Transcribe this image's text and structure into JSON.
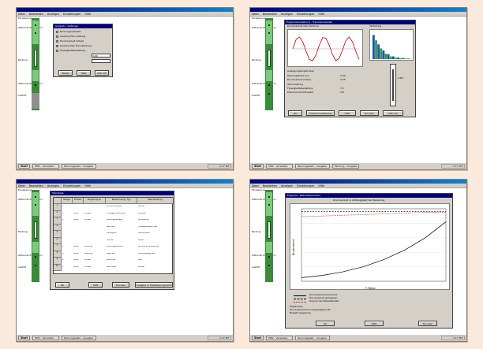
{
  "colors": {
    "desktop": "#fbe9dc",
    "titlebar": "#000080",
    "face": "#d4d0c8",
    "column": "#3a8a3a",
    "column_light": "#7fc97f"
  },
  "app": {
    "menu": [
      "Datei",
      "Bearbeiten",
      "Anzeigen",
      "Einstellungen",
      "Hilfe"
    ],
    "side_labels": {
      "top": "Einspeisung",
      "upper": "Gitterrost (Einbauten)",
      "middle": "Packung",
      "lower": "Gitterrost (Einbauten)",
      "bottom": "Austritt"
    },
    "taskbar": {
      "start": "Start",
      "task1": "PPW - Verwalten",
      "task2": "Packungswahl - Ausgabe",
      "task3": "Packung - Ausgabe",
      "tray": "2:17 PM"
    }
  },
  "shot1": {
    "dialog_title": "Auswahl - Optionen",
    "options": [
      "Packungsauswahl",
      "Gewünschte Leistung",
      "Druckverlust (mbar)",
      "Gewünschte Trennleistung",
      "Flüssigkeitsbelastung"
    ],
    "selected_index": 2,
    "field_value": "100",
    "buttons": [
      "Weiter",
      "Hilfe",
      "Abbruch"
    ]
  },
  "shot2": {
    "dialog_title": "Ergebnisdarstellung - Trennkennzahlen",
    "left_caption": "Druckverlust über Kolonne",
    "right_caption": "Verteilung",
    "info_lines": [
      "Auslegungsergebnisse",
      "Packungshöhe (m)",
      "Druckverlust (mbar)",
      "Trennleistung",
      "Flüssigkeitsbelastung",
      "Kolonnendurchmesser"
    ],
    "info_values": [
      "1,50",
      "4,35",
      "7,2",
      "3,8",
      "0,80"
    ],
    "buttons": [
      "OK",
      "Zusammenfassung",
      "Hilfe",
      "Drucken",
      "Abbruch"
    ]
  },
  "shot3": {
    "dialog_title": "Stückliste",
    "columns": [
      "Menge",
      "Einheit",
      "Zugehörig zu",
      "Bezeichnung / Typ",
      "Beschreibung"
    ],
    "rows": [
      [
        "1",
        "",
        "",
        "Kolonnenmantel",
        "Mantel"
      ],
      [
        "1",
        "Stück",
        "Einbau",
        "Flüssigkeitsverteiler",
        "Verteiler"
      ],
      [
        "2",
        "Stück",
        "Einbau",
        "Packungsauflage",
        "Auflagerost"
      ],
      [
        "",
        "",
        "",
        "Sammler",
        "Flüssigkeitssammler"
      ],
      [
        "",
        "",
        "",
        "Haltegitter",
        "Niederhalter"
      ],
      [
        "",
        "",
        "",
        "Stutzen",
        "Zulauf"
      ],
      [
        "1",
        "Stück",
        "Packung",
        "Packungselement",
        "Strukturierte Packung"
      ],
      [
        "4",
        "Stück",
        "Packung",
        "Segment",
        "Packungssegment"
      ],
      [
        "2",
        "Stück",
        "Einbau",
        "Gitterrost",
        "Rost"
      ],
      [
        "1",
        "Stück",
        "Einbau",
        "Abschluss",
        "Deckel"
      ]
    ],
    "buttons": [
      "OK",
      "Hilfe",
      "Drucken",
      "Ausgabe in Tabellenprogramm"
    ]
  },
  "shot4": {
    "dialog_title": "Ergebnis - Betriebskennlinie",
    "chart_caption": "Druckverlust in Abhängigkeit der Belastung",
    "x_label": "F-Faktor",
    "y_label": "Druckverlust",
    "legend": [
      "Druckverlust berechnet",
      "Druckverlust gemessen",
      "Grenze der Belastbarkeit"
    ],
    "notes": [
      "Ergebnisse",
      "Druckverlust bei Auslegungspunkt",
      "Belastungsgrenze"
    ],
    "buttons": [
      "OK",
      "Hilfe",
      "Drucken"
    ],
    "chart_data": {
      "type": "line",
      "series": [
        {
          "x": [
            0,
            0.5,
            1,
            1.5,
            2,
            2.5,
            3,
            3.5
          ],
          "y": [
            0.5,
            0.8,
            1.3,
            2.0,
            3.0,
            4.3,
            6.0,
            8.2
          ]
        },
        {
          "x": [
            0,
            0.5,
            1,
            1.5,
            2,
            2.5,
            3,
            3.5
          ],
          "y": [
            9.6,
            9.6,
            9.6,
            9.6,
            9.6,
            9.6,
            9.6,
            9.6
          ]
        },
        {
          "x": [
            0,
            0.5,
            1,
            1.5,
            2,
            2.5,
            3,
            3.5
          ],
          "y": [
            8.9,
            9.0,
            9.1,
            9.2,
            9.3,
            9.4,
            9.5,
            9.5
          ]
        }
      ],
      "xlim": [
        0,
        3.5
      ],
      "ylim": [
        0,
        10
      ]
    }
  },
  "shot2_chart": {
    "chart_data": {
      "type": "line",
      "series": [
        {
          "x": [
            0,
            1,
            2,
            3,
            4,
            5,
            6,
            7,
            8,
            9,
            10,
            11,
            12,
            13,
            14,
            15,
            16,
            17,
            18,
            19,
            20
          ],
          "y": [
            0,
            0.8,
            1,
            0.6,
            -0.2,
            -0.9,
            -1,
            -0.5,
            0.3,
            0.95,
            0.9,
            0.3,
            -0.5,
            -1,
            -0.8,
            -0.1,
            0.7,
            1,
            0.6,
            -0.2,
            -0.9
          ]
        }
      ],
      "ylim": [
        -1.2,
        1.2
      ]
    }
  },
  "shot2_bars": {
    "chart_data": {
      "type": "bar",
      "categories": [
        "1",
        "2",
        "3",
        "4",
        "5",
        "6",
        "7",
        "8"
      ],
      "series": [
        {
          "values": [
            90,
            55,
            32,
            18,
            10,
            6,
            4,
            2
          ]
        },
        {
          "values": [
            70,
            40,
            20,
            10,
            5,
            3,
            2,
            1
          ]
        }
      ],
      "ylim": [
        0,
        100
      ]
    }
  }
}
